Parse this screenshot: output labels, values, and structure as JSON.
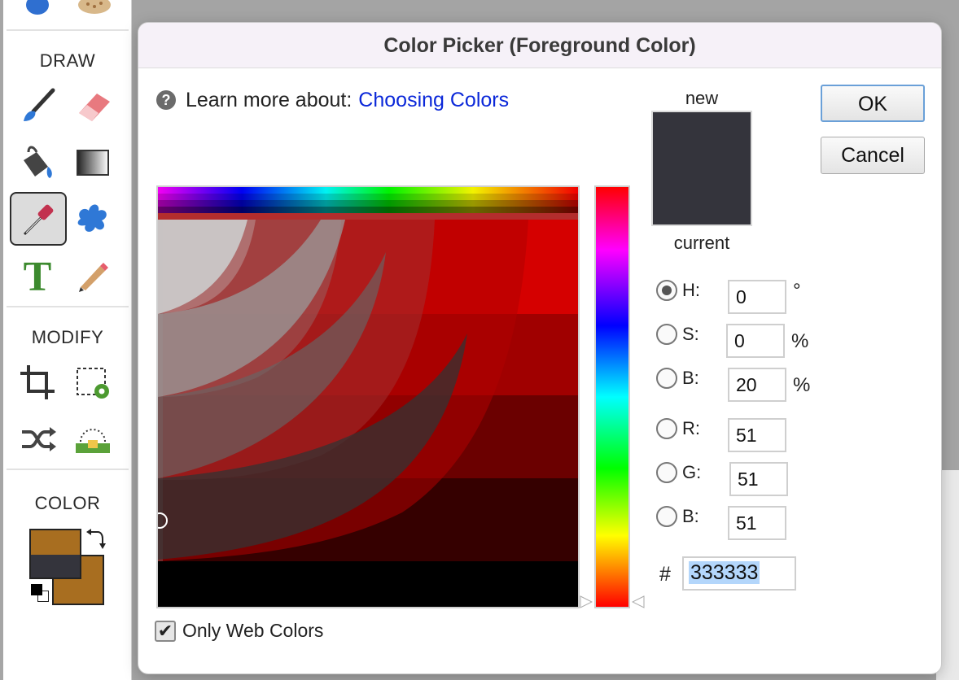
{
  "palette": {
    "sections": {
      "draw": "DRAW",
      "modify": "MODIFY",
      "color": "COLOR"
    },
    "tools": {
      "draw": [
        "paintbrush-icon",
        "eraser-icon",
        "paint-bucket-icon",
        "gradient-icon",
        "eyedropper-icon",
        "blur-icon",
        "text-icon",
        "pencil-icon"
      ],
      "modify": [
        "crop-icon",
        "selection-settings-icon",
        "shuffle-icon",
        "level-icon"
      ]
    },
    "selected_tool": "eyedropper-icon",
    "colors": {
      "foreground": "#34343c",
      "background": "#a86e20"
    }
  },
  "dialog": {
    "title": "Color Picker (Foreground Color)",
    "help": {
      "prefix": "Learn more about:",
      "link": "Choosing Colors"
    },
    "swatch": {
      "new_label": "new",
      "current_label": "current",
      "color": "#34343c"
    },
    "buttons": {
      "ok": "OK",
      "cancel": "Cancel"
    },
    "fields": {
      "h": {
        "label": "H:",
        "value": "0",
        "unit": "°"
      },
      "s": {
        "label": "S:",
        "value": "0",
        "unit": "%"
      },
      "b": {
        "label": "B:",
        "value": "20",
        "unit": "%"
      },
      "r": {
        "label": "R:",
        "value": "51"
      },
      "g": {
        "label": "G:",
        "value": "51"
      },
      "b2": {
        "label": "B:",
        "value": "51"
      }
    },
    "selected_mode": "H",
    "hex": {
      "hash": "#",
      "value": "333333"
    },
    "only_web_colors": {
      "label": "Only Web Colors",
      "checked": true
    }
  }
}
